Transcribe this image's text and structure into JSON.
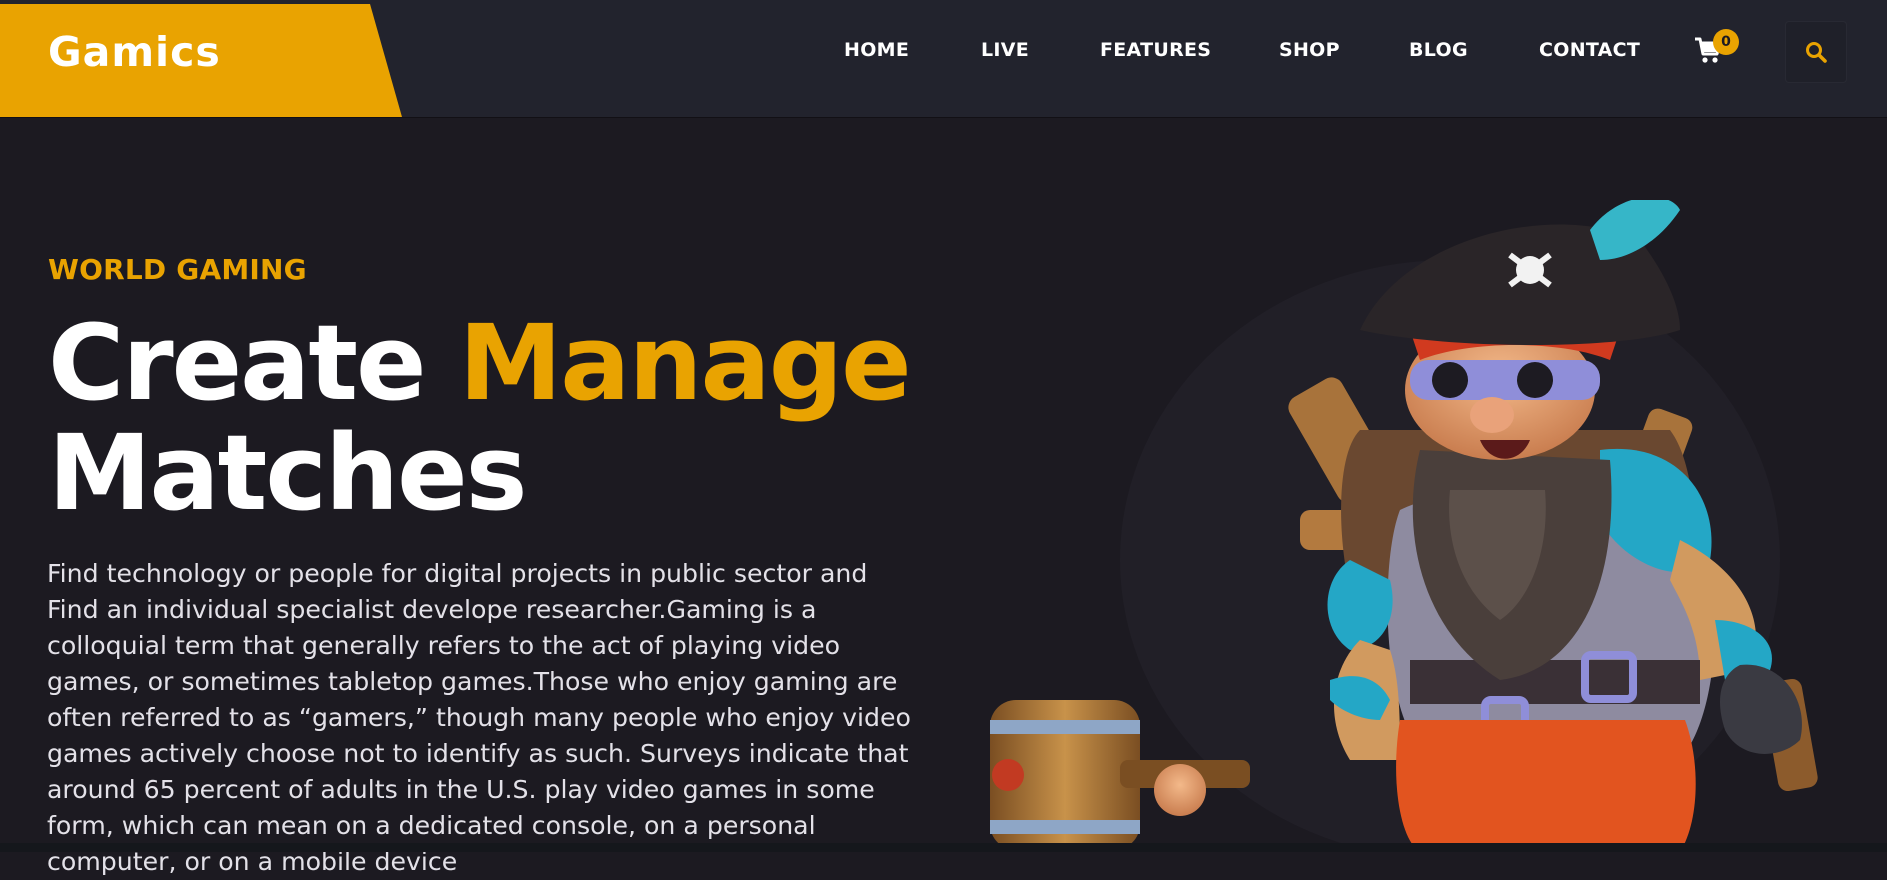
{
  "header": {
    "logo": "Gamics",
    "nav": [
      "HOME",
      "LIVE",
      "FEATURES",
      "SHOP",
      "BLOG",
      "CONTACT"
    ],
    "cart_count": "0",
    "icons": {
      "cart": "cart-icon",
      "search": "search-icon"
    }
  },
  "hero": {
    "eyebrow": "WORLD GAMING",
    "title_line1_a": "Create",
    "title_line1_b": "Manage",
    "title_line2": "Matches",
    "description": "Find technology or people for digital projects in public sector and Find an individual specialist develope researcher.Gaming is a colloquial term that generally refers to the act of playing video games, or sometimes tabletop games.Those who enjoy gaming are often referred to as “gamers,” though many people who enjoy video games actively choose not to identify as such. Surveys indicate that around 65 percent of adults in the U.S. play video games in some form, which can mean on a dedicated console, on a personal computer, or on a mobile device"
  },
  "colors": {
    "accent": "#e9a301",
    "background": "#1c1a21",
    "nav": "#22232d"
  }
}
